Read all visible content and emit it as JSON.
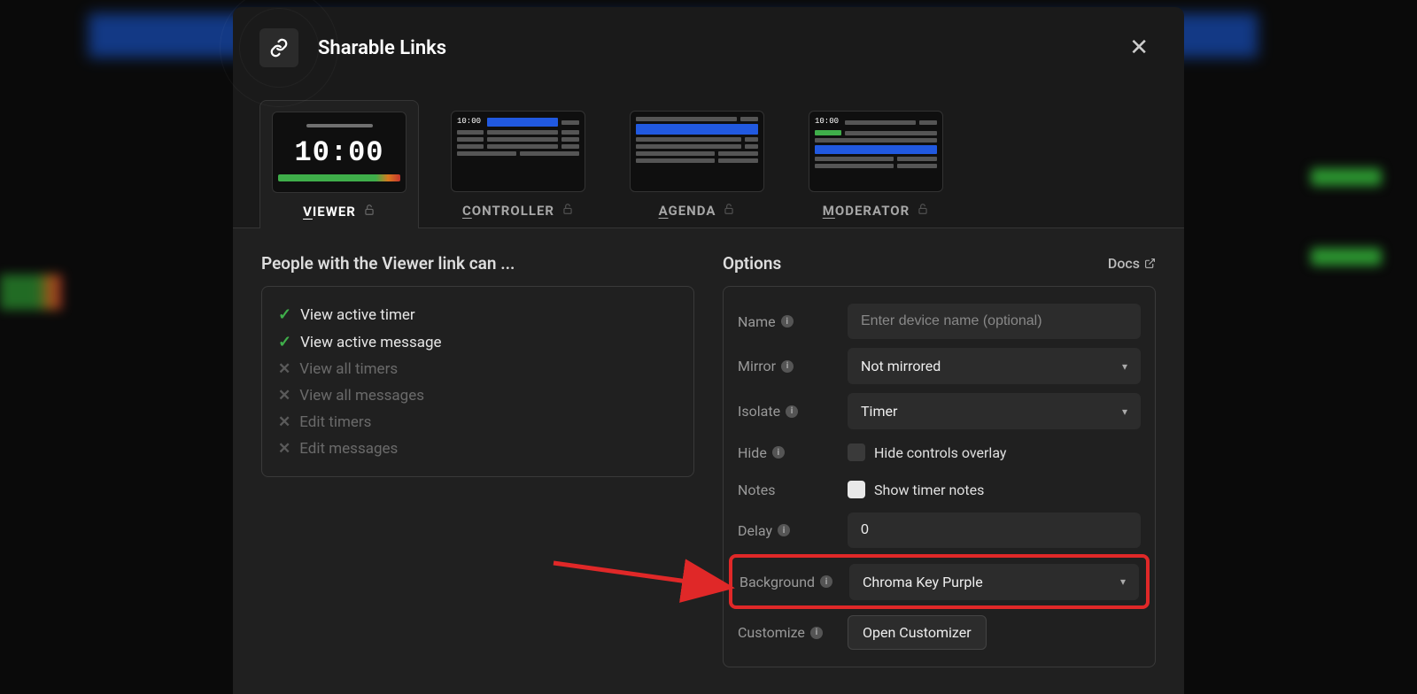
{
  "modal": {
    "title": "Sharable Links",
    "timer_preview": "10:00",
    "mini_timer": "10:00"
  },
  "tabs": [
    {
      "label_first": "V",
      "label_rest": "IEWER",
      "active": true,
      "type": "big-timer"
    },
    {
      "label_first": "C",
      "label_rest": "ONTROLLER",
      "active": false,
      "type": "list-a"
    },
    {
      "label_first": "A",
      "label_rest": "GENDA",
      "active": false,
      "type": "list-b"
    },
    {
      "label_first": "M",
      "label_rest": "ODERATOR",
      "active": false,
      "type": "list-c"
    }
  ],
  "left": {
    "subhead": "People with the Viewer link can ...",
    "perms": [
      {
        "on": true,
        "text": "View active timer"
      },
      {
        "on": true,
        "text": "View active message"
      },
      {
        "on": false,
        "text": "View all timers"
      },
      {
        "on": false,
        "text": "View all messages"
      },
      {
        "on": false,
        "text": "Edit timers"
      },
      {
        "on": false,
        "text": "Edit messages"
      }
    ]
  },
  "right": {
    "subhead": "Options",
    "docs": "Docs",
    "rows": {
      "name": {
        "label": "Name",
        "placeholder": "Enter device name (optional)"
      },
      "mirror": {
        "label": "Mirror",
        "value": "Not mirrored"
      },
      "isolate": {
        "label": "Isolate",
        "value": "Timer"
      },
      "hide": {
        "label": "Hide",
        "checkbox_label": "Hide controls overlay"
      },
      "notes": {
        "label": "Notes",
        "checkbox_label": "Show timer notes"
      },
      "delay": {
        "label": "Delay",
        "value": "0"
      },
      "background": {
        "label": "Background",
        "value": "Chroma Key Purple"
      },
      "customize": {
        "label": "Customize",
        "button": "Open Customizer"
      }
    }
  }
}
